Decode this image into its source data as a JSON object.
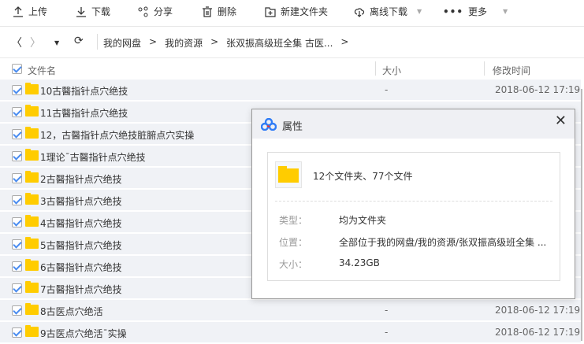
{
  "toolbar": {
    "upload": "上传",
    "download": "下载",
    "share": "分享",
    "delete": "删除",
    "new_folder": "新建文件夹",
    "offline": "离线下载",
    "more": "更多"
  },
  "breadcrumb": [
    "我的网盘",
    "我的资源",
    "张双振高级班全集 古医..."
  ],
  "columns": {
    "name": "文件名",
    "size": "大小",
    "modified": "修改时间"
  },
  "rows": [
    {
      "name": "10古醫指针点穴绝技",
      "size": "-",
      "date": "2018-06-12 17:19"
    },
    {
      "name": "11古醫指针点穴绝技"
    },
    {
      "name": "12，古醫指针点穴绝技脏腑点穴实操"
    },
    {
      "name": "1理论¯古醫指针点穴绝技"
    },
    {
      "name": "2古醫指针点穴绝技"
    },
    {
      "name": "3古醫指针点穴绝技"
    },
    {
      "name": "4古醫指针点穴绝技"
    },
    {
      "name": "5古醫指针点穴绝技"
    },
    {
      "name": "6古醫指针点穴绝技"
    },
    {
      "name": "7古醫指针点穴绝技"
    },
    {
      "name": "8古医点穴绝活",
      "size": "-",
      "date": "2018-06-12 17:19"
    },
    {
      "name": "9古医点穴绝活¯实操",
      "size": "-",
      "date": "2018-06-12 17:19"
    }
  ],
  "dialog": {
    "title": "属性",
    "summary": "12个文件夹、77个文件",
    "type_label": "类型：",
    "type_value": "均为文件夹",
    "location_label": "位置：",
    "location_value": "全部位于我的网盘/我的资源/张双振高级班全集 ...",
    "size_label": "大小：",
    "size_value": "34.23GB"
  },
  "colors": {
    "folder": "#ffcc00",
    "check": "#4a8cf0",
    "row_bg": "#f0f2f6"
  }
}
